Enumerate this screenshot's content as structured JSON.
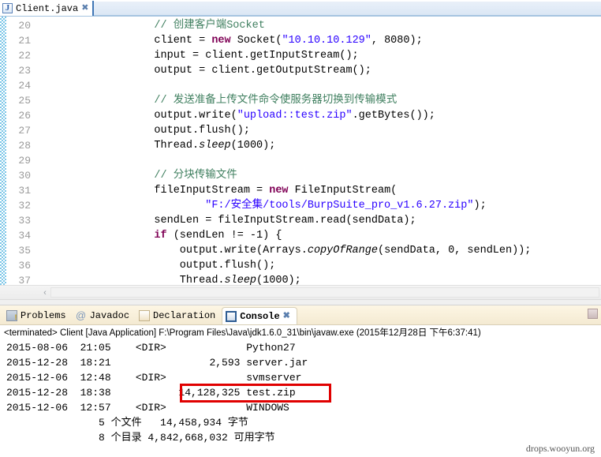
{
  "editor": {
    "tab": {
      "icon": "java-file-icon",
      "filename": "Client.java",
      "close": "✖"
    },
    "first_line": 20,
    "line_numbers": [
      "20",
      "21",
      "22",
      "23",
      "24",
      "25",
      "26",
      "27",
      "28",
      "29",
      "30",
      "31",
      "32",
      "33",
      "34",
      "35",
      "36",
      "37"
    ],
    "lines": [
      {
        "n": "20",
        "parts": [
          {
            "t": "    ",
            "c": "plain"
          },
          {
            "t": "// 创建客户端Socket",
            "c": "cmt"
          }
        ]
      },
      {
        "n": "21",
        "parts": [
          {
            "t": "    client = ",
            "c": "plain"
          },
          {
            "t": "new",
            "c": "kw"
          },
          {
            "t": " Socket(",
            "c": "plain"
          },
          {
            "t": "\"10.10.10.129\"",
            "c": "str"
          },
          {
            "t": ", 8080);",
            "c": "plain"
          }
        ]
      },
      {
        "n": "22",
        "parts": [
          {
            "t": "    input = client.getInputStream();",
            "c": "plain"
          }
        ]
      },
      {
        "n": "23",
        "parts": [
          {
            "t": "    output = client.getOutputStream();",
            "c": "plain"
          }
        ]
      },
      {
        "n": "24",
        "parts": [
          {
            "t": "",
            "c": "plain"
          }
        ]
      },
      {
        "n": "25",
        "parts": [
          {
            "t": "    ",
            "c": "plain"
          },
          {
            "t": "// 发送准备上传文件命令使服务器切换到传输模式",
            "c": "cmt"
          }
        ]
      },
      {
        "n": "26",
        "parts": [
          {
            "t": "    output.write(",
            "c": "plain"
          },
          {
            "t": "\"upload::test.zip\"",
            "c": "str"
          },
          {
            "t": ".getBytes());",
            "c": "plain"
          }
        ]
      },
      {
        "n": "27",
        "parts": [
          {
            "t": "    output.flush();",
            "c": "plain"
          }
        ]
      },
      {
        "n": "28",
        "parts": [
          {
            "t": "    Thread.",
            "c": "plain"
          },
          {
            "t": "sleep",
            "c": "it"
          },
          {
            "t": "(1000);",
            "c": "plain"
          }
        ]
      },
      {
        "n": "29",
        "parts": [
          {
            "t": "",
            "c": "plain"
          }
        ]
      },
      {
        "n": "30",
        "parts": [
          {
            "t": "    ",
            "c": "plain"
          },
          {
            "t": "// 分块传输文件",
            "c": "cmt"
          }
        ]
      },
      {
        "n": "31",
        "parts": [
          {
            "t": "    fileInputStream = ",
            "c": "plain"
          },
          {
            "t": "new",
            "c": "kw"
          },
          {
            "t": " FileInputStream(",
            "c": "plain"
          }
        ]
      },
      {
        "n": "32",
        "parts": [
          {
            "t": "            ",
            "c": "plain"
          },
          {
            "t": "\"F:/安全集/tools/BurpSuite_pro_v1.6.27.zip\"",
            "c": "str"
          },
          {
            "t": ");",
            "c": "plain"
          }
        ]
      },
      {
        "n": "33",
        "parts": [
          {
            "t": "    sendLen = fileInputStream.read(sendData);",
            "c": "plain"
          }
        ]
      },
      {
        "n": "34",
        "parts": [
          {
            "t": "    ",
            "c": "plain"
          },
          {
            "t": "if",
            "c": "kw"
          },
          {
            "t": " (sendLen != -1) {",
            "c": "plain"
          }
        ]
      },
      {
        "n": "35",
        "parts": [
          {
            "t": "        output.write(Arrays.",
            "c": "plain"
          },
          {
            "t": "copyOfRange",
            "c": "it"
          },
          {
            "t": "(sendData, 0, sendLen));",
            "c": "plain"
          }
        ]
      },
      {
        "n": "36",
        "parts": [
          {
            "t": "        output.flush();",
            "c": "plain"
          }
        ]
      },
      {
        "n": "37",
        "parts": [
          {
            "t": "        Thread.",
            "c": "plain"
          },
          {
            "t": "sleep",
            "c": "it"
          },
          {
            "t": "(1000);",
            "c": "plain"
          }
        ]
      }
    ],
    "hscroll": {
      "left_arrow": "‹"
    }
  },
  "bottom_view": {
    "tabs": [
      {
        "label": "Problems",
        "icon": "problems-icon",
        "active": false
      },
      {
        "label": "Javadoc",
        "icon": "javadoc-icon",
        "active": false
      },
      {
        "label": "Declaration",
        "icon": "declaration-icon",
        "active": false
      },
      {
        "label": "Console",
        "icon": "console-icon",
        "active": true,
        "close": "✖"
      }
    ],
    "toolbar": [
      {
        "name": "terminate-button"
      }
    ]
  },
  "console": {
    "header": "<terminated> Client [Java Application] F:\\Program Files\\Java\\jdk1.6.0_31\\bin\\javaw.exe (2015年12月28日 下午6:37:41)",
    "rows": [
      {
        "date": "2015-08-06",
        "time": "21:05",
        "size": "<DIR>",
        "name": "Python27",
        "highlight": false
      },
      {
        "date": "2015-12-28",
        "time": "18:21",
        "size": "2,593",
        "name": "server.jar",
        "highlight": false
      },
      {
        "date": "2015-12-06",
        "time": "12:48",
        "size": "<DIR>",
        "name": "svmserver",
        "highlight": false
      },
      {
        "date": "2015-12-28",
        "time": "18:38",
        "size": "14,128,325",
        "name": "test.zip",
        "highlight": true
      },
      {
        "date": "2015-12-06",
        "time": "12:57",
        "size": "<DIR>",
        "name": "WINDOWS",
        "highlight": false
      }
    ],
    "summary": [
      "               5 个文件   14,458,934 字节",
      "               8 个目录 4,842,668,032 可用字节"
    ],
    "highlight_color": "#e00000"
  },
  "watermark": "drops.wooyun.org"
}
